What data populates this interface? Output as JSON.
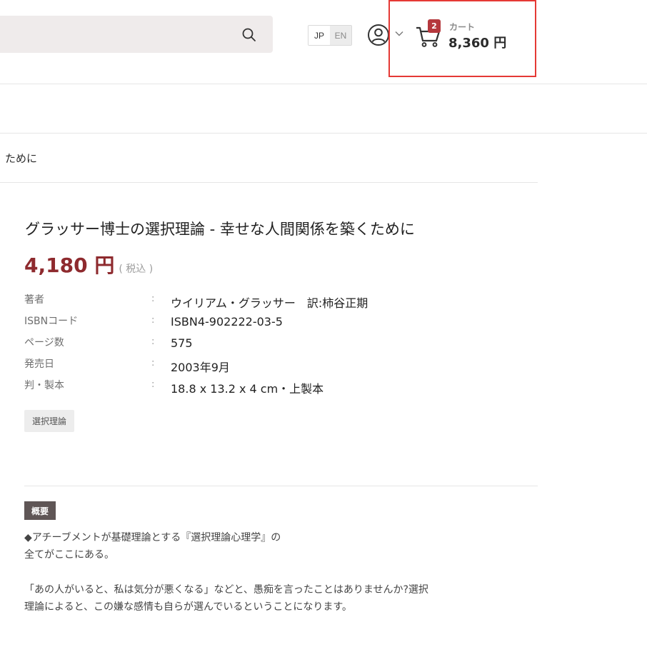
{
  "header": {
    "search": {
      "value": "",
      "placeholder": ""
    },
    "lang": {
      "jp": "JP",
      "en": "EN"
    },
    "cart": {
      "badge": "2",
      "label": "カート",
      "total": "8,360 円"
    }
  },
  "breadcrumb": {
    "current": "ために"
  },
  "product": {
    "title": "グラッサー博士の選択理論 - 幸せな人間関係を築くために",
    "price": "4,180 円",
    "tax_note": "( 税込 )",
    "specs": [
      {
        "label": "著者",
        "colon": ":",
        "value": "ウイリアム・グラッサー　訳:柿谷正期"
      },
      {
        "label": "ISBNコード",
        "colon": ":",
        "value": "ISBN4-902222-03-5"
      },
      {
        "label": "ページ数",
        "colon": ":",
        "value": "575"
      },
      {
        "label": "発売日",
        "colon": ":",
        "value": "2003年9月"
      },
      {
        "label": "判・製本",
        "colon": ":",
        "value": "18.8 x 13.2 x 4 cm・上製本"
      }
    ],
    "tag": "選択理論"
  },
  "summary": {
    "heading": "概要",
    "lines": [
      "◆アチーブメントが基礎理論とする『選択理論心理学』の",
      "全てがここにある。",
      "「あの人がいると、私は気分が悪くなる」などと、愚痴を言ったことはありませんか?選択",
      "理論によると、この嫌な感情も自らが選んでいるということになります。"
    ]
  },
  "colors": {
    "price": "#8e2a2e",
    "cart_badge": "#b5383d",
    "highlight": "#e53935",
    "summary_badge": "#5f5656"
  },
  "icons": [
    "search-icon",
    "user-icon",
    "chevron-down-icon",
    "cart-icon"
  ]
}
